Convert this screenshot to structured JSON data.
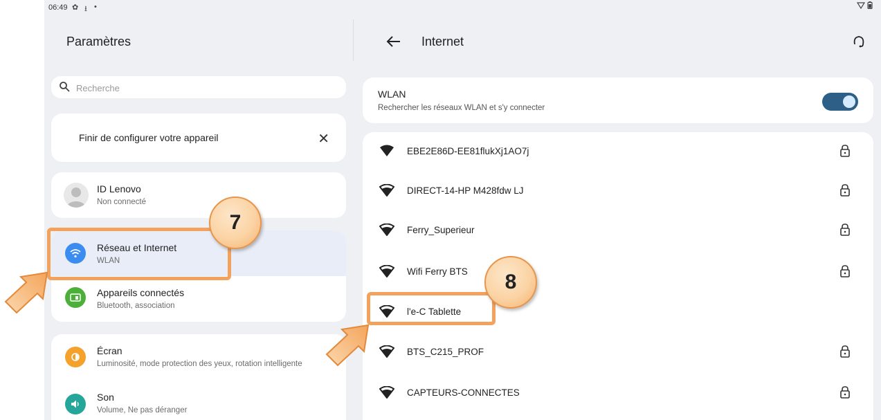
{
  "status_bar": {
    "time": "06:49"
  },
  "left": {
    "title": "Paramètres",
    "search_placeholder": "Recherche",
    "finish_setup": "Finir de configurer votre appareil",
    "lenovo": {
      "title": "ID Lenovo",
      "subtitle": "Non connecté"
    },
    "network": {
      "title": "Réseau et Internet",
      "subtitle": "WLAN"
    },
    "devices": {
      "title": "Appareils connectés",
      "subtitle": "Bluetooth, association"
    },
    "screen": {
      "title": "Écran",
      "subtitle": "Luminosité, mode protection des yeux, rotation intelligente"
    },
    "sound": {
      "title": "Son",
      "subtitle": "Volume, Ne pas déranger"
    }
  },
  "right": {
    "title": "Internet",
    "wlan": {
      "title": "WLAN",
      "subtitle": "Rechercher les réseaux WLAN et s'y connecter",
      "enabled": true
    },
    "networks": [
      {
        "name": "EBE2E86D-EE81flukXj1AO7j",
        "locked": true
      },
      {
        "name": "DIRECT-14-HP M428fdw LJ",
        "locked": true
      },
      {
        "name": "Ferry_Superieur",
        "locked": true
      },
      {
        "name": "Wifi Ferry BTS",
        "locked": true
      },
      {
        "name": "l'e-C Tablette",
        "locked": false
      },
      {
        "name": "BTS_C215_PROF",
        "locked": true
      },
      {
        "name": "CAPTEURS-CONNECTES",
        "locked": true
      }
    ]
  },
  "annotations": {
    "step_1": "7",
    "step_2": "8"
  },
  "colors": {
    "accent_toggle": "#2e5f86",
    "highlight": "#f2a25c",
    "network_icon": "#3b8cf0",
    "devices_icon": "#4caf3a",
    "screen_icon": "#f4a22c",
    "sound_icon": "#26a69a"
  }
}
